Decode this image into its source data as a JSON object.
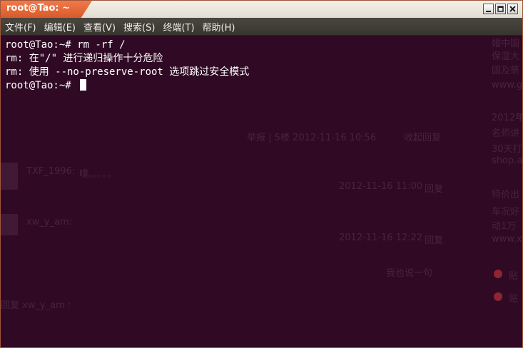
{
  "window": {
    "title": "root@Tao: ~"
  },
  "menu": [
    {
      "label": "文件(F)"
    },
    {
      "label": "编辑(E)"
    },
    {
      "label": "查看(V)"
    },
    {
      "label": "搜索(S)"
    },
    {
      "label": "终端(T)"
    },
    {
      "label": "帮助(H)"
    }
  ],
  "terminal": {
    "lines": [
      "root@Tao:~# rm -rf /",
      "rm: 在\"/\" 进行递归操作十分危险",
      "rm: 使用 --no-preserve-root 选项跳过安全模式"
    ],
    "prompt": "root@Tao:~# "
  },
  "background_page": {
    "reply_meta": "举报 | 5楼 2012-11-16 10:56",
    "collapse": "收起回复",
    "user1": "TXF_1996:",
    "user1_text": "噗。。。。。",
    "date1": "2012-11-16 11:00",
    "user2": "xw_y_am:",
    "date2": "2012-11-16 12:22",
    "reply": "回复",
    "say_one": "我也说一句",
    "reply_to": "回复 xw_y_am :",
    "side_year": "2012年",
    "side_1": "婚中国",
    "side_2": "保湿大",
    "side_3": "固及祭",
    "side_url": "www.g",
    "side_4": "名师讲",
    "side_5": "30天打",
    "side_shop": "shop.a",
    "side_6": "特价出",
    "side_7": "车况好",
    "side_8": "动1万",
    "side_url2": "www.x",
    "side_post1": "贴",
    "side_post2": "贴"
  },
  "colors": {
    "terminal_bg": "#300a24",
    "title_tab": "#e8643a",
    "menubar": "#3f3c36",
    "text": "#ffffff"
  }
}
